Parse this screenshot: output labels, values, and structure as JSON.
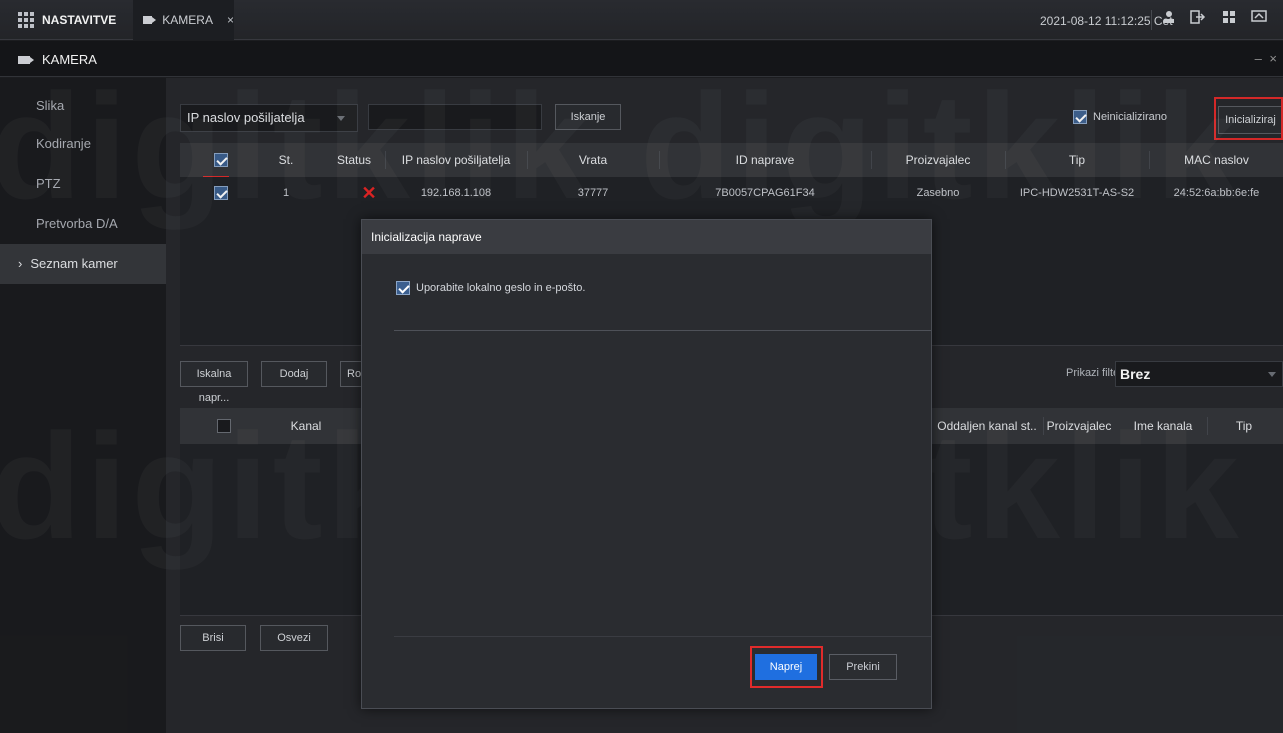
{
  "topbar": {
    "menu_label": "NASTAVITVE",
    "tab_label": "KAMERA",
    "tab_close": "×",
    "datetime": "2021-08-12 11:12:25 Cet"
  },
  "window": {
    "title": "KAMERA",
    "controls": "– ×"
  },
  "sidebar": {
    "items": [
      {
        "label": "Slika"
      },
      {
        "label": "Kodiranje"
      },
      {
        "label": "PTZ"
      },
      {
        "label": "Pretvorba D/A"
      },
      {
        "label": "Seznam kamer",
        "chevron": "›"
      }
    ]
  },
  "search": {
    "type_select": "IP naslov pošiljatelja",
    "input_value": "",
    "search_button": "Iskanje",
    "uninitialized_label": "Neinicializirano",
    "initialize_button": "Inicializiraj"
  },
  "device_table": {
    "headers": [
      "St.",
      "Status",
      "IP naslov pošiljatelja",
      "Vrata",
      "ID naprave",
      "Proizvajalec",
      "Tip",
      "MAC naslov"
    ],
    "row": {
      "num": "1",
      "status": "✕",
      "ip": "192.168.1.108",
      "port": "37777",
      "device_id": "7B0057CPAG61F34",
      "manufacturer": "Zasebno",
      "type": "IPC-HDW2531T-AS-S2",
      "mac": "24:52:6a:bb:6e:fe"
    }
  },
  "actions": {
    "search_device": "Iskalna napr...",
    "add": "Dodaj",
    "third": "Ro",
    "filter_label": "Prikazi filter",
    "filter_value": "Brez"
  },
  "channel_table": {
    "headers": [
      "Kanal",
      "Oddaljen kanal st..",
      "Proizvajalec",
      "Ime kanala",
      "Tip"
    ]
  },
  "bottom": {
    "delete": "Brisi",
    "refresh": "Osvezi"
  },
  "dialog": {
    "title": "Inicializacija naprave",
    "option": "Uporabite lokalno geslo in e-pošto.",
    "next": "Naprej",
    "cancel": "Prekini"
  },
  "watermark": {
    "text": "digitklik"
  },
  "colors": {
    "accent": "#1f6fe0",
    "highlight": "#e02b2b",
    "status_error": "#e62525"
  }
}
